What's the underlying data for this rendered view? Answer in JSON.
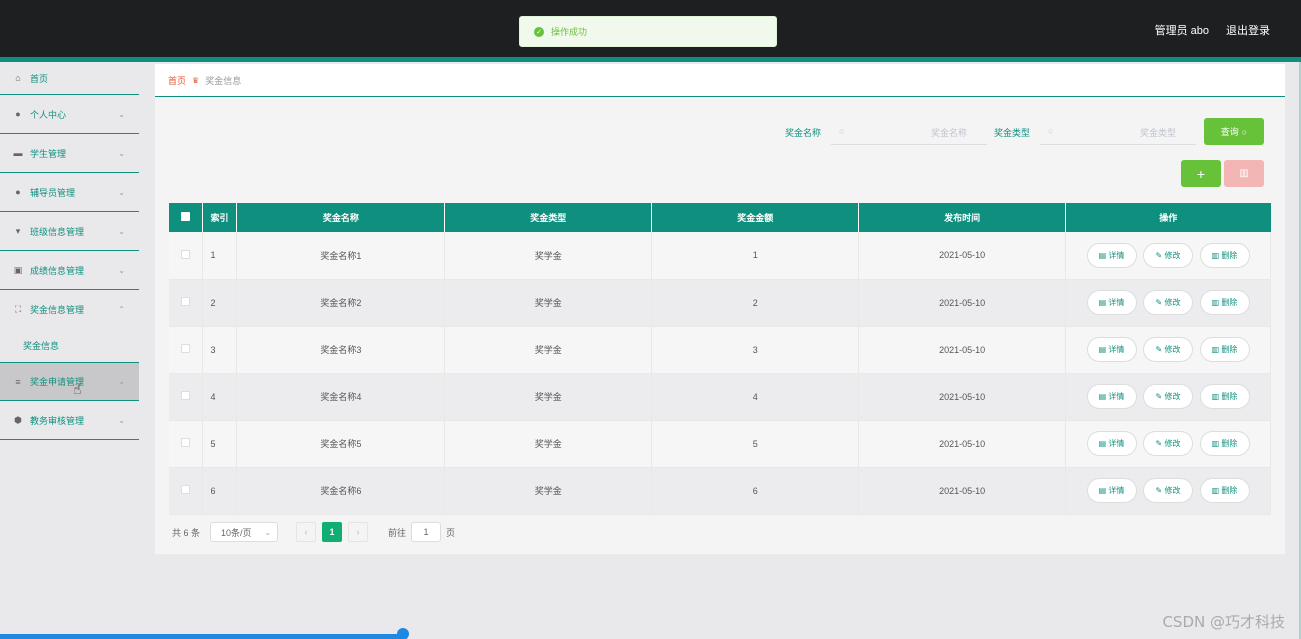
{
  "header": {
    "toast": "操作成功",
    "user_label": "管理员 abo",
    "logout_label": "退出登录"
  },
  "sidebar": {
    "items": [
      {
        "label": "首页",
        "icon": "home-icon"
      },
      {
        "label": "个人中心",
        "icon": "user-icon"
      },
      {
        "label": "学生管理",
        "icon": "briefcase-icon"
      },
      {
        "label": "辅导员管理",
        "icon": "user-icon"
      },
      {
        "label": "班级信息管理",
        "icon": "flag-icon"
      },
      {
        "label": "成绩信息管理",
        "icon": "image-icon"
      },
      {
        "label": "奖金信息管理",
        "icon": "fullscreen-icon"
      },
      {
        "label": "奖金申请管理",
        "icon": "list-icon"
      },
      {
        "label": "教务审核管理",
        "icon": "shield-icon"
      }
    ],
    "submenu": {
      "label": "奖金信息"
    }
  },
  "breadcrumb": {
    "home": "首页",
    "current": "奖金信息"
  },
  "search": {
    "name_label": "奖金名称",
    "name_placeholder": "奖金名称",
    "type_label": "奖金类型",
    "type_placeholder": "奖金类型",
    "query_label": "查询"
  },
  "table": {
    "headers": [
      "索引",
      "奖金名称",
      "奖金类型",
      "奖金金额",
      "发布时间",
      "操作"
    ],
    "rows": [
      {
        "index": "1",
        "name": "奖金名称1",
        "type": "奖学金",
        "amount": "1",
        "date": "2021-05-10"
      },
      {
        "index": "2",
        "name": "奖金名称2",
        "type": "奖学金",
        "amount": "2",
        "date": "2021-05-10"
      },
      {
        "index": "3",
        "name": "奖金名称3",
        "type": "奖学金",
        "amount": "3",
        "date": "2021-05-10"
      },
      {
        "index": "4",
        "name": "奖金名称4",
        "type": "奖学金",
        "amount": "4",
        "date": "2021-05-10"
      },
      {
        "index": "5",
        "name": "奖金名称5",
        "type": "奖学金",
        "amount": "5",
        "date": "2021-05-10"
      },
      {
        "index": "6",
        "name": "奖金名称6",
        "type": "奖学金",
        "amount": "6",
        "date": "2021-05-10"
      }
    ],
    "actions": {
      "detail": "详情",
      "edit": "修改",
      "delete": "删除"
    }
  },
  "pagination": {
    "total": "共 6 条",
    "page_size": "10条/页",
    "current": "1",
    "goto_label": "前往",
    "goto_value": "1",
    "page_suffix": "页"
  },
  "watermark": "CSDN @巧才科技",
  "colors": {
    "primary": "#0f8f7e",
    "success": "#67c23a",
    "danger_light": "#f4b5b5",
    "topbar": "#1e1f21"
  }
}
